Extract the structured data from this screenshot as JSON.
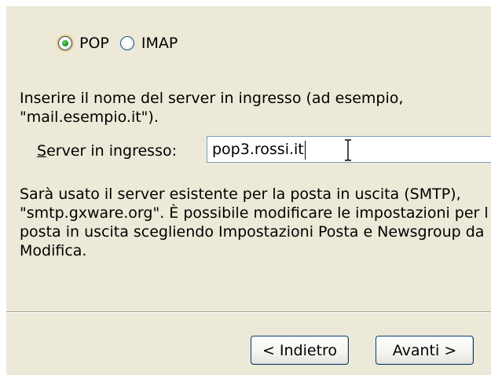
{
  "protocol": {
    "options": [
      {
        "label": "POP",
        "checked": true
      },
      {
        "label": "IMAP",
        "checked": false
      }
    ]
  },
  "incoming": {
    "instruction_line1": "Inserire il nome del server in ingresso (ad esempio,",
    "instruction_line2": "\"mail.esempio.it\").",
    "label_mnemonic": "S",
    "label_rest": "erver in ingresso:",
    "value": "pop3.rossi.it"
  },
  "outgoing": {
    "line1": "Sarà usato il server esistente per la posta in uscita (SMTP),",
    "line2": "\"smtp.gxware.org\". È possibile modificare le impostazioni per l",
    "line3": "posta in uscita scegliendo Impostazioni Posta e Newsgroup da",
    "line4": "Modifica."
  },
  "buttons": {
    "back_label": "< Indietro",
    "next_label": "Avanti >"
  },
  "colors": {
    "dialog_background": "#ece9d8",
    "input_border": "#7f9db9",
    "button_border": "#003c74",
    "radio_checked": "#21a121"
  }
}
